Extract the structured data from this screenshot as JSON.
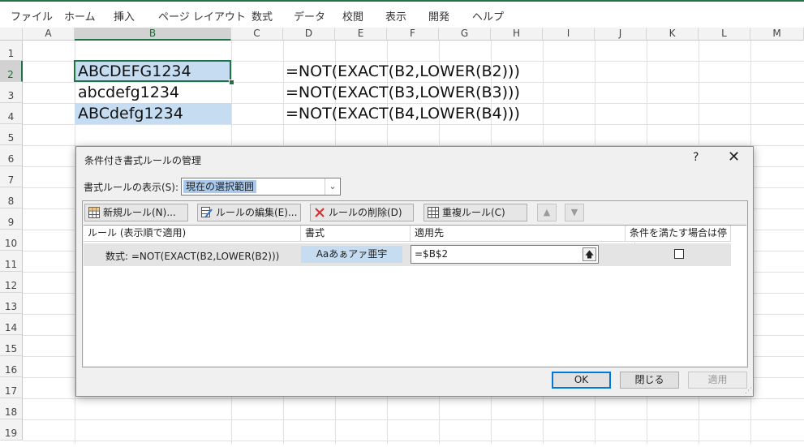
{
  "ribbon": {
    "tabs": [
      "ファイル",
      "ホーム",
      "挿入",
      "ページ レイアウト",
      "数式",
      "データ",
      "校閲",
      "表示",
      "開発",
      "ヘルプ"
    ]
  },
  "sheet": {
    "columns": [
      "A",
      "B",
      "C",
      "D",
      "E",
      "F",
      "G",
      "H",
      "I",
      "J",
      "K",
      "L",
      "M"
    ],
    "rows": [
      "1",
      "2",
      "3",
      "4",
      "5",
      "6",
      "7",
      "8",
      "9",
      "10",
      "11",
      "12",
      "13",
      "14",
      "15",
      "16",
      "17",
      "18",
      "19"
    ],
    "cells": {
      "b2": "ABCDEFG1234",
      "b3": "abcdefg1234",
      "b4": "ABCdefg1234",
      "d2": "=NOT(EXACT(B2,LOWER(B2)))",
      "d3": "=NOT(EXACT(B3,LOWER(B3)))",
      "d4": "=NOT(EXACT(B4,LOWER(B4)))"
    },
    "highlight_color": "#c5dcf1",
    "selection_color": "#217346"
  },
  "dialog": {
    "title": "条件付き書式ルールの管理",
    "help": "?",
    "close": "✕",
    "show_label": "書式ルールの表示(S):",
    "show_value": "現在の選択範囲",
    "toolbar": {
      "new_rule": "新規ルール(N)...",
      "edit_rule": "ルールの編集(E)...",
      "delete_rule": "ルールの削除(D)",
      "duplicate_rule": "重複ルール(C)",
      "move_up": "▲",
      "move_down": "▼"
    },
    "list_headers": {
      "rule": "ルール (表示順で適用)",
      "format": "書式",
      "applies_to": "適用先",
      "stop_if_true": "条件を満たす場合は停止"
    },
    "rule": {
      "text": "数式: =NOT(EXACT(B2,LOWER(B2)))",
      "format_sample": "Aaあぁアァ亜宇",
      "applies_to": "=$B$2",
      "stop_if_true": false
    },
    "buttons": {
      "ok": "OK",
      "close": "閉じる",
      "apply": "適用"
    }
  }
}
